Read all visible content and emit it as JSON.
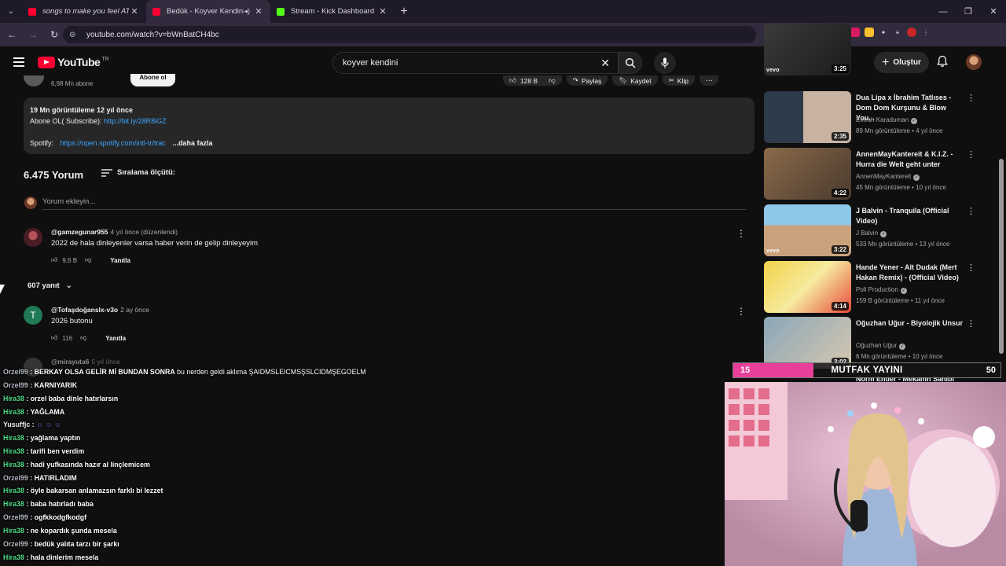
{
  "browser": {
    "tabs": [
      {
        "title": "songs to make you feel ATTR",
        "active": false
      },
      {
        "title": "Bedük - Koyver Kendini - Yo",
        "active": true
      },
      {
        "title": "Stream - Kick Dashboard",
        "active": false
      }
    ],
    "url": "youtube.com/watch?v=bWnBatCH4bc"
  },
  "yt": {
    "logo": "YouTube",
    "region": "TR",
    "search_value": "koyver kendini",
    "create_label": "Oluştur"
  },
  "video": {
    "subscribers": "6,98 Mn abone",
    "subscribe_label": "Abone ol",
    "likes": "128 B",
    "share": "Paylaş",
    "save": "Kaydet",
    "clip": "Klip",
    "views_line": "19 Mn görüntüleme  12 yıl önce",
    "desc_sub_label": "Abone OL( Subscribe):",
    "desc_sub_link": "http://bit.ly/28R8iGZ",
    "desc_spotify_label": "Spotify:",
    "desc_spotify_link": "https://open.spotify.com/intl-tr/trac",
    "desc_more": "...daha fazla"
  },
  "comments": {
    "count": "6.475 Yorum",
    "sort_label": "Sıralama ölçütü:",
    "add_placeholder": "Yorum ekleyin...",
    "reply_label": "Yanıtla",
    "items": [
      {
        "user": "@gamzegunar955",
        "time": "4 yıl önce (düzenlendi)",
        "text": "2022 de hala dinleyenler varsa haber verin de gelip dinleyeyim",
        "likes": "9,6 B",
        "replies": "607 yanıt"
      },
      {
        "user": "@Tofaşdoğanslx-v3o",
        "time": "2 ay önce",
        "text": "2026 butonu",
        "likes": "116",
        "replies": ""
      },
      {
        "user": "@mirayuta6",
        "time": "5 yıl önce",
        "text": "",
        "likes": "",
        "replies": ""
      }
    ]
  },
  "recommendations": [
    {
      "title": "",
      "channel": "",
      "meta": "",
      "duration": "3:25",
      "vevo": "vevo"
    },
    {
      "title": "Dua Lipa x İbrahim Tatlıses - Dom Dom Kurşunu & Blow You...",
      "channel": "Emrah Karaduman",
      "meta": "89 Mn görüntüleme • 4 yıl önce",
      "duration": "2:35",
      "vevo": ""
    },
    {
      "title": "AnnenMayKantereit & K.I.Z. - Hurra die Welt geht unter",
      "channel": "AnnenMayKantereit",
      "meta": "45 Mn görüntüleme • 10 yıl önce",
      "duration": "4:22",
      "vevo": ""
    },
    {
      "title": "J Balvin - Tranquila (Official Video)",
      "channel": "J Balvin",
      "meta": "533 Mn görüntüleme • 13 yıl önce",
      "duration": "3:22",
      "vevo": "vevo"
    },
    {
      "title": "Hande Yener - Alt Dudak (Mert Hakan Remix) - (Official Video)",
      "channel": "Poll Production",
      "meta": "159 B görüntüleme • 11 yıl önce",
      "duration": "4:14",
      "vevo": ""
    },
    {
      "title": "Oğuzhan Uğur - Biyolojik Unsur",
      "channel": "Oğuzhan Uğur",
      "meta": "6 Mn görüntüleme • 10 yıl önce",
      "duration": "3:02",
      "vevo": ""
    },
    {
      "title": "Norm Ender - Mekanın Sahibi",
      "channel": "",
      "meta": "",
      "duration": "",
      "vevo": ""
    }
  ],
  "stream": {
    "level": "15",
    "label": "MUTFAK YAYINI",
    "goal": "50",
    "progress_fraction": 0.3
  },
  "chat": [
    {
      "user": "Orzel99",
      "msg": "BERKAY OLSA GELİR Mİ BUNDAN SONRA",
      "extra": " bu nerden geldi aklıma ŞAIDMSLEICMSŞSLCIDMŞEGOELM",
      "color": "o"
    },
    {
      "user": "Orzel99",
      "msg": "KARNIYARIK",
      "extra": "",
      "color": "o"
    },
    {
      "user": "Hira38",
      "msg": "orzel baba dinle hatırlarsın",
      "extra": "",
      "color": "h"
    },
    {
      "user": "Hira38",
      "msg": "YAĞLAMA",
      "extra": "",
      "color": "h"
    },
    {
      "user": "Yusuffjc",
      "msg": "",
      "extra": "",
      "color": "y"
    },
    {
      "user": "Hira38",
      "msg": "yağlama yaptın",
      "extra": "",
      "color": "h"
    },
    {
      "user": "Hira38",
      "msg": "tarifi ben verdim",
      "extra": "",
      "color": "h"
    },
    {
      "user": "Hira38",
      "msg": "hadi yufkasında hazır al linçlemicem",
      "extra": "",
      "color": "h"
    },
    {
      "user": "Orzel99",
      "msg": "HATIRLADIM",
      "extra": "",
      "color": "o"
    },
    {
      "user": "Hira38",
      "msg": "öyle bakarsan anlamazsın farklı bi lezzet",
      "extra": "",
      "color": "h"
    },
    {
      "user": "Hira38",
      "msg": "baba hatırladı baba",
      "extra": "",
      "color": "h"
    },
    {
      "user": "Orzel99",
      "msg": "ogfkkodgfkodgf",
      "extra": "",
      "color": "o"
    },
    {
      "user": "Hira38",
      "msg": "ne kopardık şunda mesela",
      "extra": "",
      "color": "h"
    },
    {
      "user": "Orzel99",
      "msg": "bedük yalıta tarzı bir şarkı",
      "extra": "",
      "color": "o"
    },
    {
      "user": "Hira38",
      "msg": "hala dinlerim mesela",
      "extra": "",
      "color": "h"
    }
  ]
}
